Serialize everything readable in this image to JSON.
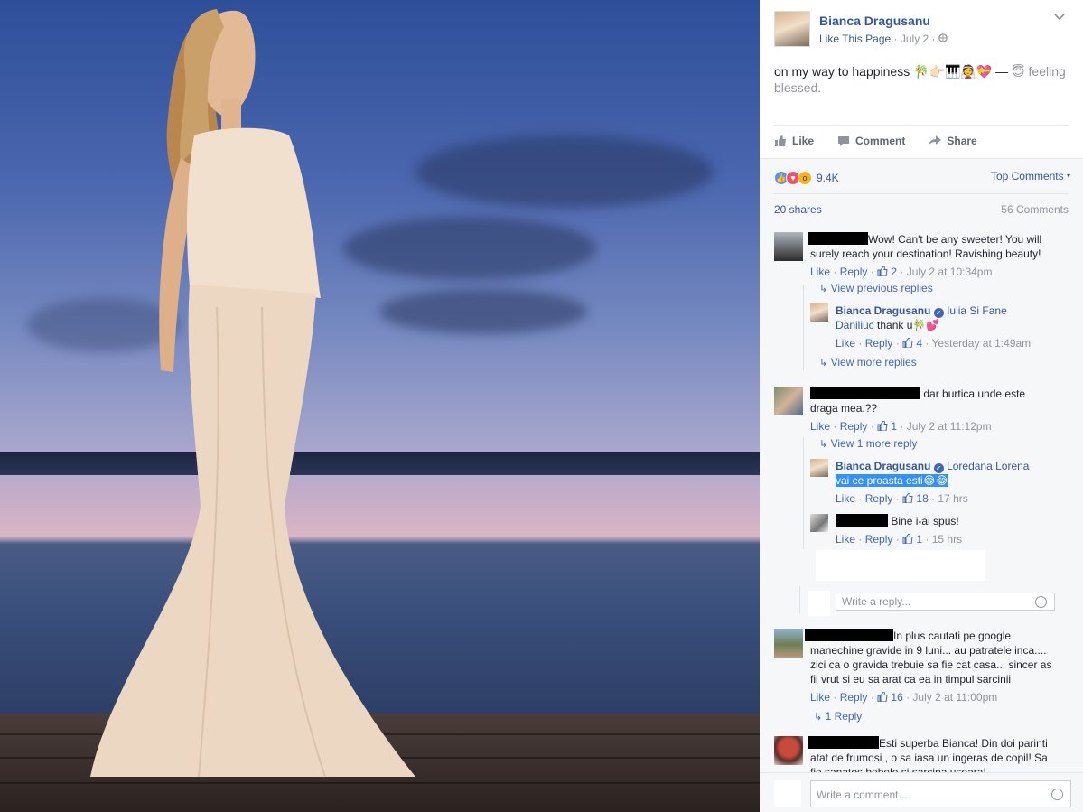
{
  "post": {
    "author": "Bianca Dragusanu",
    "like_page": "Like This Page",
    "date": "July 2",
    "text": "on my way to happiness 🎋👉🏻🎹👰💝 — ",
    "feeling": "😇 feeling blessed."
  },
  "actions": {
    "like": "Like",
    "comment": "Comment",
    "share": "Share"
  },
  "stats": {
    "reactions_count": "9.4K",
    "top_comments": "Top Comments",
    "shares": "20 shares",
    "comments": "56 Comments"
  },
  "comments": [
    {
      "text_1": "Wow! Can't be any sweeter! You will",
      "text_2": "surely reach your destination! Ravishing beauty!",
      "like": "Like",
      "reply": "Reply",
      "likes": "2",
      "time": "July 2 at 10:34pm",
      "view_previous": "View previous replies",
      "replies": [
        {
          "author": "Bianca Dragusanu",
          "tag_1": "Iulia Si Fane",
          "tag_2": "Daniliuc",
          "text": "thank u🎋💕",
          "like": "Like",
          "reply": "Reply",
          "likes": "4",
          "time": "Yesterday at 1:49am"
        }
      ],
      "view_more": "View more replies"
    },
    {
      "text_1": "dar burtica unde este",
      "text_2": "draga mea.??",
      "like": "Like",
      "reply": "Reply",
      "likes": "1",
      "time": "July 2 at 11:12pm",
      "view_more": "View 1 more reply",
      "replies": [
        {
          "author": "Bianca Dragusanu",
          "tag": "Loredana Lorena",
          "text": "vai ce proasta esti😂😂",
          "like": "Like",
          "reply": "Reply",
          "likes": "18",
          "time": "17 hrs"
        },
        {
          "text": "Bine i-ai spus!",
          "like": "Like",
          "reply": "Reply",
          "likes": "1",
          "time": "15 hrs"
        }
      ],
      "reply_placeholder": "Write a reply..."
    },
    {
      "text_1": "In plus cautati pe google",
      "text_2": "manechine gravide in 9 luni... au patratele inca....",
      "text_3": "zici ca o gravida trebuie sa fie cat casa... sincer as",
      "text_4": "fii vrut si eu sa arat ca ea in timpul sarcinii",
      "like": "Like",
      "reply": "Reply",
      "likes": "16",
      "time": "July 2 at 11:00pm",
      "replies_link": "1 Reply"
    },
    {
      "text_1": "Esti superba Bianca! Din doi parinti",
      "text_2": "atat de frumosi , o sa iasa un ingeras de copil! Sa",
      "text_3": "fie sanatos bebele si sarcina usoara!"
    }
  ],
  "composer": {
    "placeholder": "Write a comment..."
  },
  "icons": [
    "like-icon",
    "comment-icon",
    "share-icon",
    "globe-icon",
    "chevron-down-icon",
    "emoji-icon",
    "reply-arrow-icon",
    "verified-badge-icon"
  ],
  "colors": {
    "link": "#365899",
    "muted": "#90949c",
    "panel_bg": "#f6f7f9",
    "highlight": "#3390ff"
  }
}
